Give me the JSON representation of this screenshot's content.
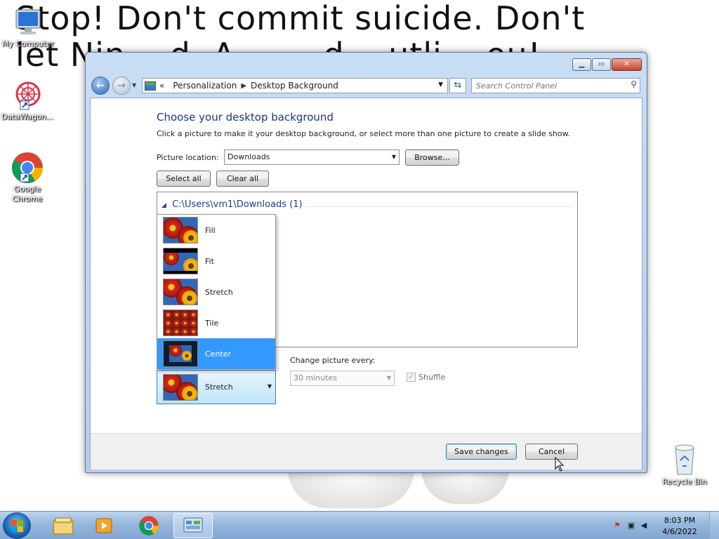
{
  "wallpaper": {
    "line1": "Stop! Don't commit suicide. Don't",
    "line2": "let Nin    d  A        d    utli    ou!"
  },
  "desktop_icons": [
    {
      "label": "My Computer",
      "icon": "computer-icon"
    },
    {
      "label": "DataWagon...",
      "icon": "datawagon-icon"
    },
    {
      "label": "Google Chrome",
      "icon": "chrome-icon"
    },
    {
      "label": "Recycle Bin",
      "icon": "recycle-bin-icon"
    }
  ],
  "window": {
    "breadcrumb": [
      "Personalization",
      "Desktop Background"
    ],
    "breadcrumb_prefix": "«",
    "search_placeholder": "Search Control Panel",
    "heading": "Choose your desktop background",
    "subheading": "Click a picture to make it your desktop background, or select more than one picture to create a slide show.",
    "picture_location_label": "Picture location:",
    "picture_location_value": "Downloads",
    "browse_label": "Browse...",
    "select_all_label": "Select all",
    "clear_all_label": "Clear all",
    "folder_header": "C:\\Users\\vm1\\Downloads (1)",
    "picture_position": {
      "options": [
        "Fill",
        "Fit",
        "Stretch",
        "Tile",
        "Center"
      ],
      "highlighted": "Center",
      "current": "Stretch"
    },
    "change_picture_label": "Change picture every:",
    "change_picture_value": "30 minutes",
    "shuffle_label": "Shuffle",
    "save_label": "Save changes",
    "cancel_label": "Cancel"
  },
  "taskbar": {
    "time": "8:03 PM",
    "date": "4/6/2022",
    "items": [
      "windows-explorer-icon",
      "media-player-icon",
      "chrome-icon",
      "control-panel-icon"
    ]
  },
  "colors": {
    "heading": "#1e3287",
    "selection": "#3399ff",
    "taskbar": "#96b7dd"
  }
}
